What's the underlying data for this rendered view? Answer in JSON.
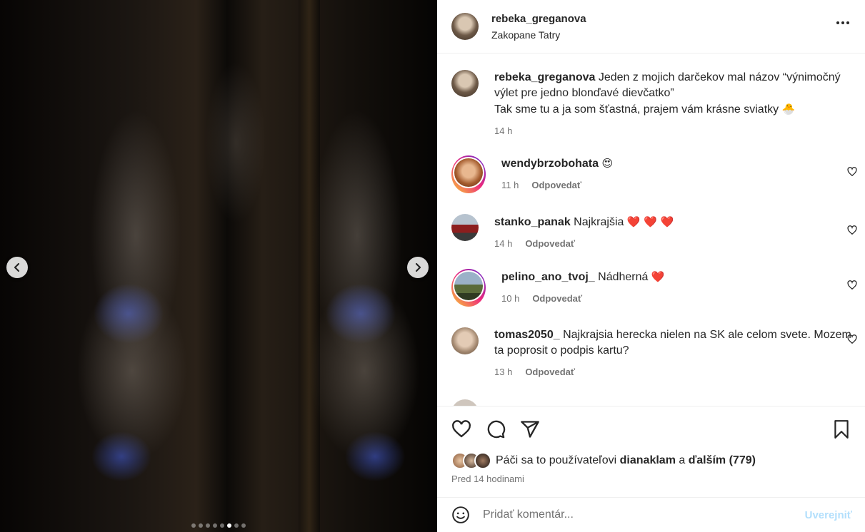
{
  "post": {
    "slide_count": 8,
    "active_slide": 6
  },
  "header": {
    "username": "rebeka_greganova",
    "location": "Zakopane Tatry"
  },
  "caption": {
    "username": "rebeka_greganova",
    "text_line1": "Jeden z mojich darčekov mal názov “výnimočný výlet pre jedno blonďavé dievčatko”",
    "text_line2": "Tak sme tu a ja som šťastná, prajem vám krásne sviatky",
    "emoji": "🐣",
    "time": "14 h"
  },
  "comments": [
    {
      "username": "wendybrzobohata",
      "text": "",
      "emoji": "😍",
      "time": "11 h",
      "reply_label": "Odpovedať"
    },
    {
      "username": "stanko_panak",
      "text": "Najkrajšia",
      "emoji": "❤️ ❤️ ❤️",
      "time": "14 h",
      "reply_label": "Odpovedať"
    },
    {
      "username": "pelino_ano_tvoj_",
      "text": "Nádherná",
      "emoji": "❤️",
      "time": "10 h",
      "reply_label": "Odpovedať"
    },
    {
      "username": "tomas2050_",
      "text": "Najkrajsia herecka nielen na SK ale celom svete. Mozem ta poprosit o podpis kartu?",
      "emoji": "",
      "time": "13 h",
      "reply_label": "Odpovedať"
    }
  ],
  "likes": {
    "prefix": "Páči sa to používateľovi",
    "user": "dianaklam",
    "middle": "a",
    "others": "ďalším (779)"
  },
  "time_ago": "Pred 14 hodinami",
  "comment_box": {
    "placeholder": "Pridať komentár...",
    "post_label": "Uverejniť"
  },
  "colors": {
    "accent": "#0095f6",
    "post_disabled": "#b2dffc",
    "heart": "#ed4956"
  }
}
